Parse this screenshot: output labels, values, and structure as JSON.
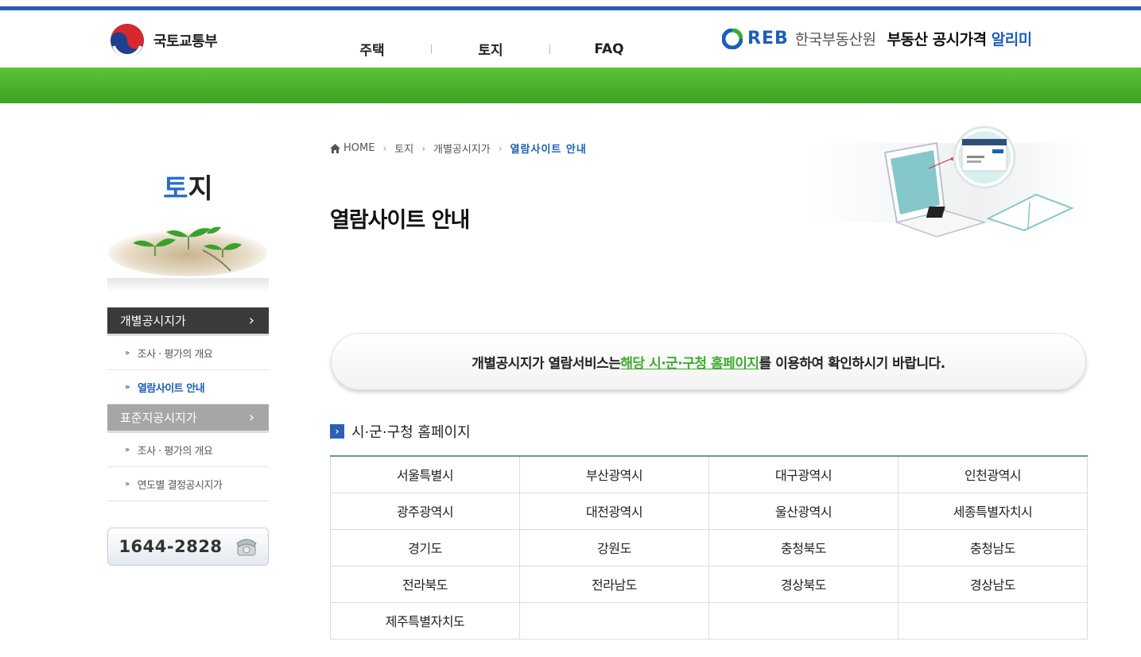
{
  "header": {
    "ministry_name": "국토교통부",
    "nav": [
      "주택",
      "토지",
      "FAQ"
    ],
    "reb_logo": "REB",
    "reb_korean": "한국부동산원",
    "service_name_prefix": "부동산 공시가격",
    "service_name_accent": "알리미",
    "brand_blue": "#1c5fb8",
    "brand_green": "#47b02a"
  },
  "sidebar": {
    "title_first": "토",
    "title_rest": "지",
    "menu1": {
      "label": "개별공시지가",
      "items": [
        "조사 · 평가의 개요",
        "열람사이트 안내"
      ]
    },
    "menu2": {
      "label": "표준지공시지가",
      "items": [
        "조사 · 평가의 개요",
        "연도별 결정공시지가"
      ]
    },
    "phone": "1644-2828"
  },
  "breadcrumb": {
    "items": [
      "HOME",
      "토지",
      "개별공시지가",
      "열람사이트 안내"
    ]
  },
  "page_title": "열람사이트 안내",
  "notice": {
    "before": "개별공시지가 열람서비스는 ",
    "highlight": "해당 시·군·구청 홈페이지",
    "after": "를 이용하여 확인하시기 바랍니다."
  },
  "section_title": "시·군·구청 홈페이지",
  "sites_table": {
    "rows": [
      [
        "서울특별시",
        "부산광역시",
        "대구광역시",
        "인천광역시"
      ],
      [
        "광주광역시",
        "대전광역시",
        "울산광역시",
        "세종특별자치시"
      ],
      [
        "경기도",
        "강원도",
        "충청북도",
        "충청남도"
      ],
      [
        "전라북도",
        "전라남도",
        "경상북도",
        "경상남도"
      ],
      [
        "제주특별자치도",
        "",
        "",
        ""
      ]
    ]
  },
  "icons": {
    "ministry_logo": "taeguk-emblem-icon",
    "reb_logo": "reb-logo-icon",
    "home": "home-icon",
    "phone": "telephone-icon",
    "section": "arrow-box-icon"
  }
}
